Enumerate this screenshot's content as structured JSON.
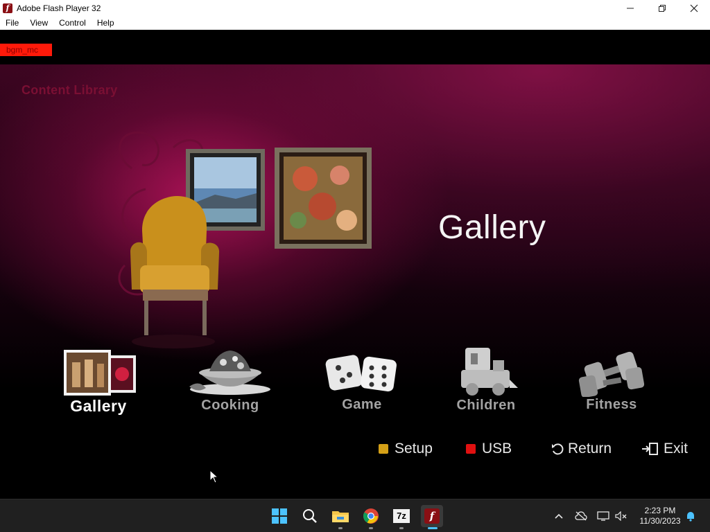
{
  "window": {
    "title": "Adobe Flash Player 32",
    "menu": [
      "File",
      "View",
      "Control",
      "Help"
    ]
  },
  "stage": {
    "debug_label": "bgm_mc",
    "section_title": "Content Library",
    "highlight_title": "Gallery",
    "categories": [
      {
        "label": "Gallery",
        "icon": "gallery-icon",
        "selected": true
      },
      {
        "label": "Cooking",
        "icon": "cooking-icon",
        "selected": false
      },
      {
        "label": "Game",
        "icon": "dice-icon",
        "selected": false
      },
      {
        "label": "Children",
        "icon": "toy-train-icon",
        "selected": false
      },
      {
        "label": "Fitness",
        "icon": "dumbbell-icon",
        "selected": false
      }
    ],
    "controls": {
      "setup": "Setup",
      "usb": "USB",
      "return_label": "Return",
      "exit": "Exit"
    },
    "colors": {
      "setup_key": "#d4a017",
      "usb_key": "#e01010",
      "accent": "#b0145c"
    }
  },
  "taskbar": {
    "apps": [
      "start-icon",
      "search-icon",
      "file-explorer-icon",
      "chrome-icon",
      "7zip-icon",
      "flash-player-icon"
    ],
    "seven_zip_text": "7z",
    "clock_time": "2:23 PM",
    "clock_date": "11/30/2023"
  }
}
